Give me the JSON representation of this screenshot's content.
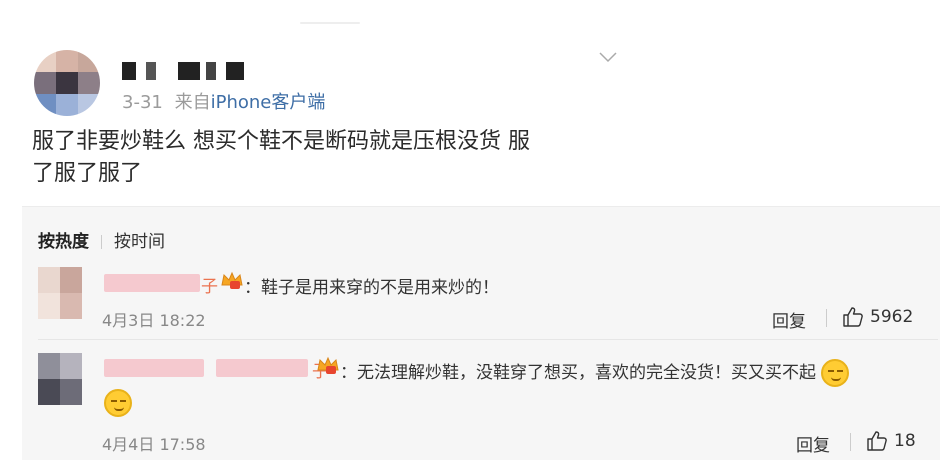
{
  "post": {
    "meta_date": "3-31",
    "meta_from": "来自",
    "meta_source": "iPhone客户端",
    "text_line1": "服了非要炒鞋么 想买个鞋不是断码就是压根没货 服",
    "text_line2": "了服了服了"
  },
  "sort_tabs": {
    "hot": "按热度",
    "time": "按时间"
  },
  "comments": [
    {
      "name_visible_char": "子",
      "text": "：鞋子是用来穿的不是用来炒的！",
      "time": "4月3日 18:22",
      "reply_label": "回复",
      "like_count": "5962"
    },
    {
      "name_visible_char": "子",
      "text": "：无法理解炒鞋，没鞋穿了想买，喜欢的完全没货！买又买不起",
      "time": "4月4日 17:58",
      "reply_label": "回复",
      "like_count": "18"
    }
  ],
  "colors": {
    "link": "#3e6ea6",
    "meta": "#9b9b9b",
    "comments_bg": "#f6f6f6",
    "name_orange": "#eb7350"
  }
}
